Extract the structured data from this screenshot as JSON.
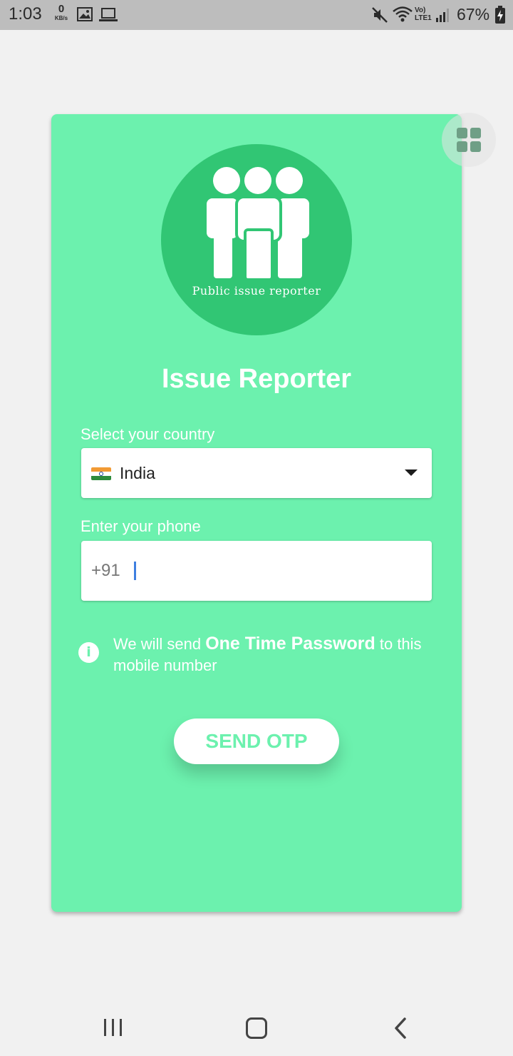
{
  "status_bar": {
    "time": "1:03",
    "net_speed_value": "0",
    "net_speed_unit": "KB/s",
    "network_label": "Vo) LTE1",
    "battery_percent": "67%"
  },
  "logo": {
    "text": "Public issue reporter",
    "color": "#31c674"
  },
  "app": {
    "title": "Issue Reporter"
  },
  "country": {
    "label": "Select your country",
    "selected": "India",
    "flag": "india-flag-icon"
  },
  "phone": {
    "label": "Enter your phone",
    "prefix": "+91",
    "value": ""
  },
  "info": {
    "text_before": "We will send",
    "text_bold": "One Time Password",
    "text_after": "to this mobile number"
  },
  "send_button": {
    "label": "SEND OTP"
  },
  "colors": {
    "card": "#6cf1ae",
    "accent": "#31c674",
    "background": "#f1f1f1"
  }
}
